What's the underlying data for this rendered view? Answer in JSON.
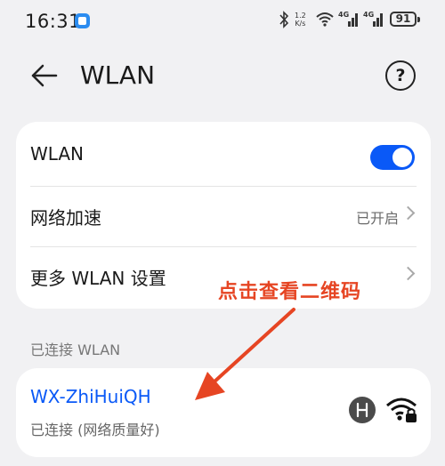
{
  "status_bar": {
    "time": "16:31",
    "speed_value": "1.2",
    "speed_unit": "K/s",
    "signal1_label": "4G",
    "signal2_label": "4G",
    "battery": "91"
  },
  "header": {
    "title": "WLAN",
    "help_glyph": "?"
  },
  "settings": {
    "rows": [
      {
        "label": "WLAN"
      },
      {
        "label": "网络加速",
        "value": "已开启"
      },
      {
        "label": "更多 WLAN 设置"
      }
    ],
    "wlan_enabled": true
  },
  "annotation": {
    "text": "点击查看二维码",
    "color": "#e64523"
  },
  "connected_section": {
    "title": "已连接 WLAN",
    "network": {
      "name": "WX-ZhiHuiQH",
      "status": "已连接 (网络质量好)"
    }
  },
  "colors": {
    "accent": "#0a59f7",
    "background": "#f1f1f3"
  },
  "icons": [
    "notification-icon",
    "bluetooth-icon",
    "wifi-status-icon",
    "signal-icon",
    "battery-icon",
    "back-arrow-icon",
    "help-icon",
    "chevron-right-icon",
    "hilink-icon",
    "wifi-lock-icon"
  ]
}
